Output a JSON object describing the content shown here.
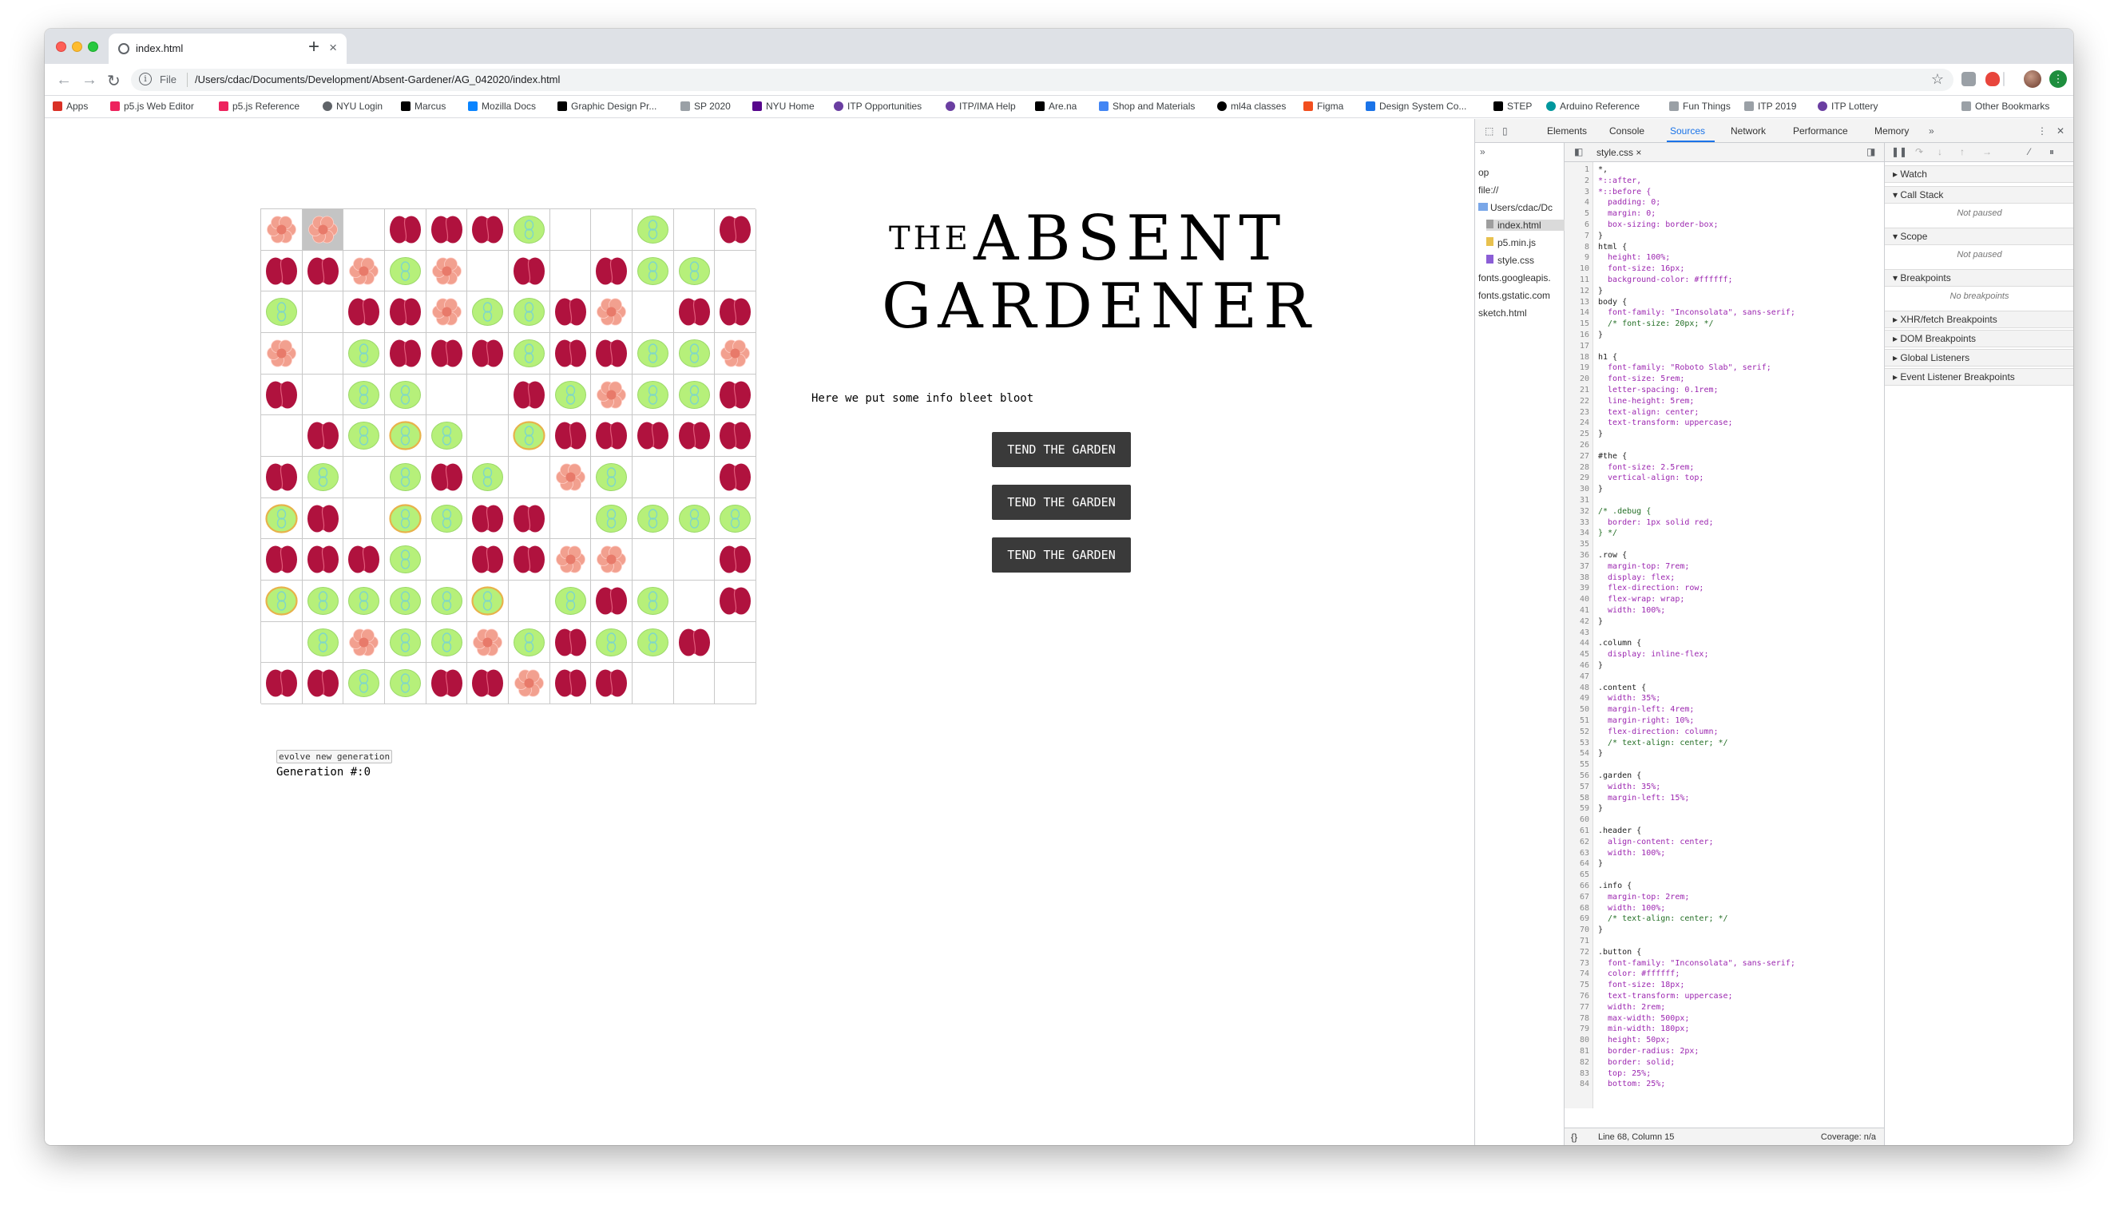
{
  "browser": {
    "tab_title": "index.html",
    "url_scheme": "File",
    "url": "/Users/cdac/Documents/Development/Absent-Gardener/AG_042020/index.html"
  },
  "bookmarks": [
    {
      "label": "Apps",
      "icon": "apps-grid-icon",
      "color": "#d93025"
    },
    {
      "label": "p5.js Web Editor",
      "icon": "p5-asterisk-icon",
      "color": "#ed225d"
    },
    {
      "label": "p5.js Reference",
      "icon": "p5-asterisk-icon",
      "color": "#ed225d"
    },
    {
      "label": "NYU Login",
      "icon": "globe-icon",
      "color": "#5f6368"
    },
    {
      "label": "Marcus",
      "icon": "m-icon",
      "color": "#000000"
    },
    {
      "label": "Mozilla Docs",
      "icon": "mozilla-icon",
      "color": "#0a84ff"
    },
    {
      "label": "Graphic Design Pr...",
      "icon": "gd-icon",
      "color": "#000000"
    },
    {
      "label": "SP 2020",
      "icon": "folder-icon",
      "color": "#5f6368"
    },
    {
      "label": "NYU Home",
      "icon": "nyu-icon",
      "color": "#57068c"
    },
    {
      "label": "ITP Opportunities",
      "icon": "itp-icon",
      "color": "#6a3ea1"
    },
    {
      "label": "ITP/IMA Help",
      "icon": "itp-icon",
      "color": "#6a3ea1"
    },
    {
      "label": "Are.na",
      "icon": "arena-icon",
      "color": "#000000"
    },
    {
      "label": "Shop and Materials",
      "icon": "doc-icon",
      "color": "#4285f4"
    },
    {
      "label": "ml4a classes",
      "icon": "github-icon",
      "color": "#000000"
    },
    {
      "label": "Figma",
      "icon": "figma-icon",
      "color": "#f24e1e"
    },
    {
      "label": "Design System Co...",
      "icon": "dsc-icon",
      "color": "#1a73e8"
    },
    {
      "label": "STEP",
      "icon": "sc-icon",
      "color": "#000000"
    },
    {
      "label": "Arduino Reference",
      "icon": "arduino-icon",
      "color": "#00979d"
    },
    {
      "label": "Fun Things",
      "icon": "folder-icon",
      "color": "#5f6368"
    },
    {
      "label": "ITP 2019",
      "icon": "folder-icon",
      "color": "#5f6368"
    },
    {
      "label": "ITP Lottery",
      "icon": "itp-icon",
      "color": "#6a3ea1"
    },
    {
      "label": "Other Bookmarks",
      "icon": "folder-icon",
      "color": "#5f6368"
    }
  ],
  "page": {
    "title_the": "THE",
    "title_absent": "ABSENT",
    "title_gardener": "GARDENER",
    "info": "Here we put some info bleet bloot",
    "buttons": [
      "TEND THE GARDEN",
      "TEND THE GARDEN",
      "TEND THE GARDEN"
    ],
    "evolve_label": "evolve new generation",
    "generation": "Generation #:0",
    "plant_legend": {
      "P": "pink-flower",
      "R": "red-bulb",
      "G": "green-pod",
      "Y": "yellow-pod",
      "E": "empty"
    },
    "grid": [
      "PPERRRGEEGER",
      "RRPGPERERGGE",
      "GERRPGGRPERR",
      "PEGRRRGRRGGP",
      "REGGEERGPGGR",
      "ERGYGEYRRRRR",
      "RGEGRGEPGEER",
      "YREYGRREGGGG",
      "RRRGERRPPEER",
      "YGGGGYEGRGER",
      "EGPGGPGRGGRE",
      "RRGGRRPRREEE"
    ],
    "selected_cell": {
      "row": 0,
      "col": 1
    }
  },
  "devtools": {
    "tabs": [
      "Elements",
      "Console",
      "Sources",
      "Network",
      "Performance",
      "Memory"
    ],
    "active_tab": "Sources",
    "nav_items": [
      "op",
      "file://",
      "Users/cdac/Dc",
      "index.html",
      "p5.min.js",
      "style.css",
      "fonts.googleapis.",
      "fonts.gstatic.com",
      "sketch.html"
    ],
    "open_file": "style.css",
    "code_lines": [
      "*,",
      "*::after,",
      "*::before {",
      "  padding: 0;",
      "  margin: 0;",
      "  box-sizing: border-box;",
      "}",
      "html {",
      "  height: 100%;",
      "  font-size: 16px;",
      "  background-color: #ffffff;",
      "}",
      "body {",
      "  font-family: \"Inconsolata\", sans-serif;",
      "  /* font-size: 20px; */",
      "}",
      "",
      "h1 {",
      "  font-family: \"Roboto Slab\", serif;",
      "  font-size: 5rem;",
      "  letter-spacing: 0.1rem;",
      "  line-height: 5rem;",
      "  text-align: center;",
      "  text-transform: uppercase;",
      "}",
      "",
      "#the {",
      "  font-size: 2.5rem;",
      "  vertical-align: top;",
      "}",
      "",
      "/* .debug {",
      "  border: 1px solid red;",
      "} */",
      "",
      ".row {",
      "  margin-top: 7rem;",
      "  display: flex;",
      "  flex-direction: row;",
      "  flex-wrap: wrap;",
      "  width: 100%;",
      "}",
      "",
      ".column {",
      "  display: inline-flex;",
      "}",
      "",
      ".content {",
      "  width: 35%;",
      "  margin-left: 4rem;",
      "  margin-right: 10%;",
      "  flex-direction: column;",
      "  /* text-align: center; */",
      "}",
      "",
      ".garden {",
      "  width: 35%;",
      "  margin-left: 15%;",
      "}",
      "",
      ".header {",
      "  align-content: center;",
      "  width: 100%;",
      "}",
      "",
      ".info {",
      "  margin-top: 2rem;",
      "  width: 100%;",
      "  /* text-align: center; */",
      "}",
      "",
      ".button {",
      "  font-family: \"Inconsolata\", sans-serif;",
      "  color: #ffffff;",
      "  font-size: 18px;",
      "  text-transform: uppercase;",
      "  width: 2rem;",
      "  max-width: 500px;",
      "  min-width: 180px;",
      "  height: 50px;",
      "  border-radius: 2px;",
      "  border: solid;",
      "  top: 25%;",
      "  bottom: 25%;"
    ],
    "status_position": "Line 68, Column 15",
    "status_coverage": "Coverage: n/a",
    "right_panes": [
      {
        "label": "Watch",
        "note": ""
      },
      {
        "label": "Call Stack",
        "note": "Not paused"
      },
      {
        "label": "Scope",
        "note": "Not paused"
      },
      {
        "label": "Breakpoints",
        "note": "No breakpoints"
      },
      {
        "label": "XHR/fetch Breakpoints",
        "note": ""
      },
      {
        "label": "DOM Breakpoints",
        "note": ""
      },
      {
        "label": "Global Listeners",
        "note": ""
      },
      {
        "label": "Event Listener Breakpoints",
        "note": ""
      }
    ]
  },
  "colors": {
    "pink_flower": "#f2a08f",
    "pink_flower_center": "#e87a6a",
    "red_bulb": "#b0123e",
    "red_bulb_line": "#e25a7a",
    "green_pod": "#b6f07a",
    "green_pod_line": "#7fd7c8",
    "yellow_pod_edge": "#e8b24a",
    "button_bg": "#3a3a3a",
    "devtools_accent": "#1a73e8"
  }
}
